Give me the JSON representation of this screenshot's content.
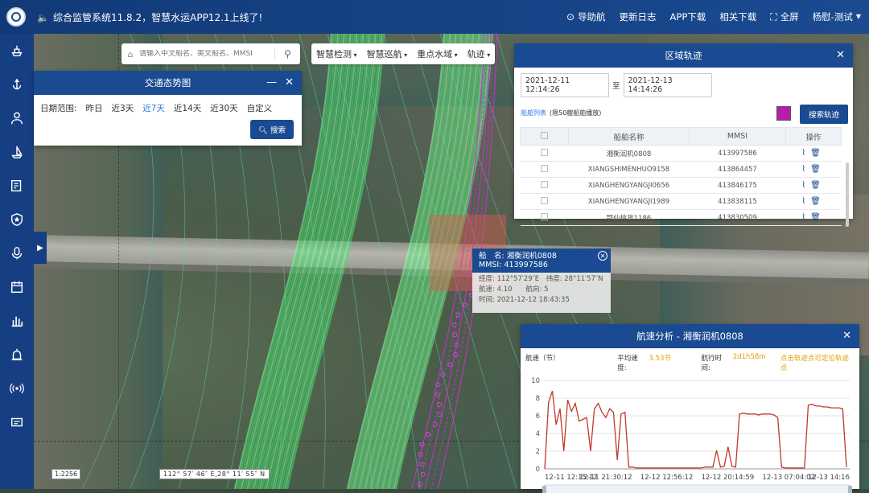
{
  "topbar": {
    "notice": "综合监管系统11.8.2，智慧水运APP12.1上线了!",
    "nav": [
      {
        "label": "导助航",
        "icon": "help-icon"
      },
      {
        "label": "更新日志",
        "icon": ""
      },
      {
        "label": "APP下载",
        "icon": ""
      },
      {
        "label": "相关下载",
        "icon": ""
      },
      {
        "label": "全屏",
        "icon": "fullscreen-icon"
      },
      {
        "label": "杨慰-测试",
        "icon": ""
      }
    ]
  },
  "sidebar": {
    "items": [
      "ship-icon",
      "anchor-icon",
      "person-icon",
      "sailboat-icon",
      "report-icon",
      "badge-icon",
      "mic-icon",
      "calendar-icon",
      "chart-icon",
      "alarm-icon",
      "broadcast-icon",
      "message-icon"
    ]
  },
  "search": {
    "placeholder": "请输入中文船名、英文船名、MMSI"
  },
  "menu": [
    "智慧检测",
    "智慧巡航",
    "重点水域",
    "轨迹"
  ],
  "traffic": {
    "title": "交通态势图",
    "date_label": "日期范围:",
    "ranges": [
      "昨日",
      "近3天",
      "近7天",
      "近14天",
      "近30天",
      "自定义"
    ],
    "selected": "近7天",
    "search_btn": "搜索"
  },
  "track": {
    "title": "区域轨迹",
    "start": "2021-12-11 12:14:26",
    "sep": "至",
    "end": "2021-12-13 14:14:26",
    "list_label": "船舶列表",
    "list_note": "(限50艘船舶播放)",
    "search_btn": "搜索轨迹",
    "color": "#b41eaa",
    "columns": [
      "船舶名称",
      "MMSI",
      "操作"
    ],
    "rows": [
      {
        "name": "湘衡润机0808",
        "mmsi": "413997586"
      },
      {
        "name": "XIANGSHIMENHUO9158",
        "mmsi": "413864457"
      },
      {
        "name": "XIANGHENGYANGJI0656",
        "mmsi": "413846175"
      },
      {
        "name": "XIANGHENGYANGJI1989",
        "mmsi": "413838115"
      },
      {
        "name": "鄂仙桃货1186",
        "mmsi": "413830509"
      }
    ]
  },
  "popup": {
    "name_label": "船　名:",
    "name": "湘衡润机0808",
    "mmsi_label": "MMSI:",
    "mmsi": "413997586",
    "lon_label": "经度:",
    "lon": "112°57′29″E",
    "lat_label": "纬度:",
    "lat": "28°11′57″N",
    "speed_label": "航速:",
    "speed": "4.10",
    "course_label": "航向:",
    "course": "5",
    "time_label": "时间:",
    "time": "2021-12-12 18:43:35"
  },
  "map": {
    "scale": "1:2256",
    "coord": "112° 57′ 46″ E,28° 11′ 55″ N"
  },
  "speed": {
    "title": "航速分析 - 湘衡润机0808",
    "ylabel": "航速（节）",
    "avg_label": "平均速度:",
    "avg": "3.53节",
    "dur_label": "航行时间:",
    "dur": "2d1h58m",
    "hint": "点击轨迹点可定位轨迹点"
  },
  "chart_data": {
    "type": "line",
    "title": "",
    "ylabel": "航速（节）",
    "ylim": [
      0,
      10
    ],
    "yticks": [
      0,
      2,
      4,
      6,
      8,
      10
    ],
    "xtick_labels": [
      "12-11 12:15:12",
      "12-11 21:30:12",
      "12-12 12:56:12",
      "12-12 20:14:59",
      "12-13 07:04:02",
      "12-13 14:16"
    ],
    "series": [
      {
        "color": "#c0392b",
        "values": [
          0,
          7.5,
          8.8,
          5,
          6.8,
          2,
          7.8,
          6.5,
          7.4,
          5.4,
          5.6,
          5.8,
          2,
          6.8,
          7.4,
          6.4,
          5.8,
          6.8,
          6.4,
          1,
          6.2,
          6.4,
          0.2,
          0.2,
          0.1,
          0.1,
          0.1,
          0.1,
          0.1,
          0.1,
          0.1,
          0.1,
          0.1,
          0.1,
          0.1,
          0.1,
          0.1,
          0.1,
          0.1,
          0.1,
          0.1,
          0.1,
          0.2,
          0.2,
          0.2,
          2.1,
          0.2,
          0.3,
          2.5,
          0.3,
          0.2,
          6.2,
          6.3,
          6.2,
          6.2,
          6.2,
          6.1,
          6.2,
          6.2,
          6.2,
          6.1,
          5.8,
          0.2,
          0.1,
          0.1,
          0.1,
          0.1,
          0.1,
          0.1,
          7.2,
          7.3,
          7.1,
          7.1,
          7.0,
          7.0,
          6.9,
          6.9,
          6.9,
          6.8,
          0.2
        ]
      }
    ]
  }
}
